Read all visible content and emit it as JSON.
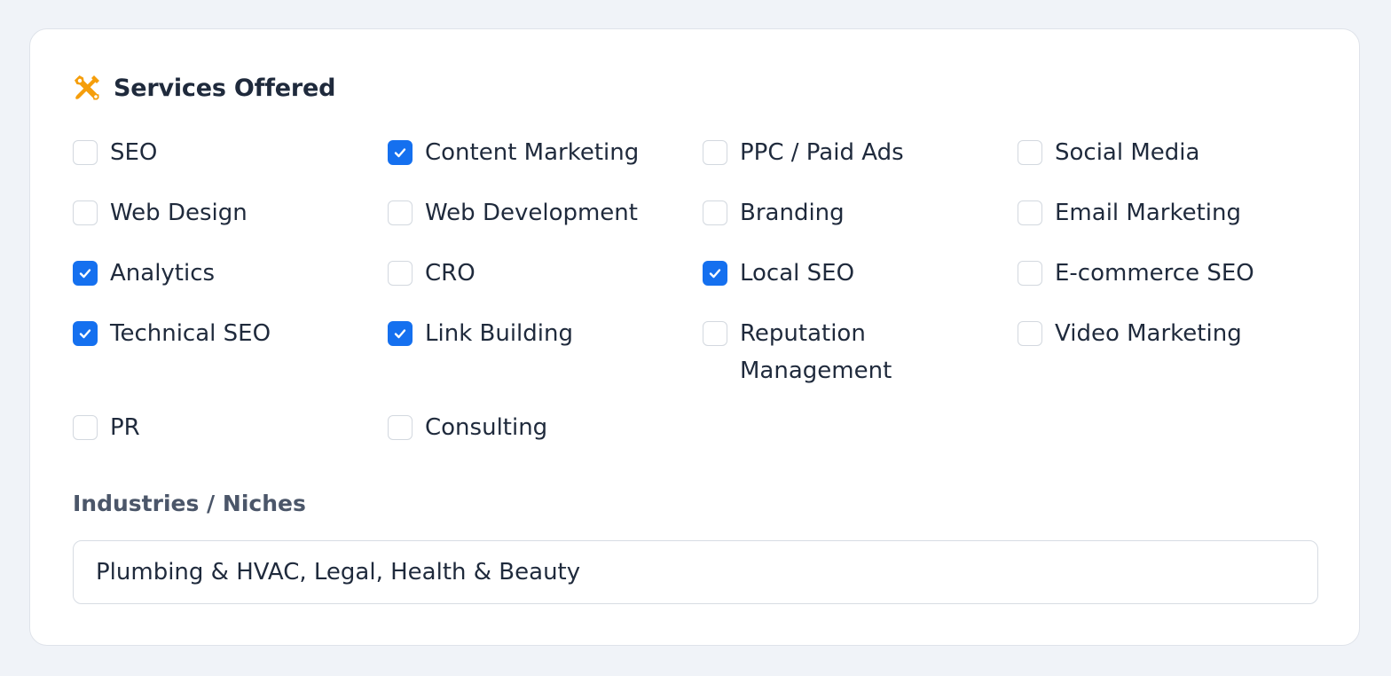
{
  "section": {
    "title": "Services Offered",
    "icon": "tools-icon",
    "icon_color": "#f59e0b"
  },
  "accent_color": "#1570ef",
  "services": [
    {
      "label": "SEO",
      "checked": false
    },
    {
      "label": "Content Marketing",
      "checked": true
    },
    {
      "label": "PPC / Paid Ads",
      "checked": false
    },
    {
      "label": "Social Media",
      "checked": false
    },
    {
      "label": "Web Design",
      "checked": false
    },
    {
      "label": "Web Development",
      "checked": false
    },
    {
      "label": "Branding",
      "checked": false
    },
    {
      "label": "Email Marketing",
      "checked": false
    },
    {
      "label": "Analytics",
      "checked": true
    },
    {
      "label": "CRO",
      "checked": false
    },
    {
      "label": "Local SEO",
      "checked": true
    },
    {
      "label": "E-commerce SEO",
      "checked": false
    },
    {
      "label": "Technical SEO",
      "checked": true
    },
    {
      "label": "Link Building",
      "checked": true
    },
    {
      "label": "Reputation Management",
      "checked": false
    },
    {
      "label": "Video Marketing",
      "checked": false
    },
    {
      "label": "PR",
      "checked": false
    },
    {
      "label": "Consulting",
      "checked": false
    }
  ],
  "industries": {
    "label": "Industries / Niches",
    "value": "Plumbing & HVAC, Legal, Health & Beauty",
    "placeholder": ""
  }
}
